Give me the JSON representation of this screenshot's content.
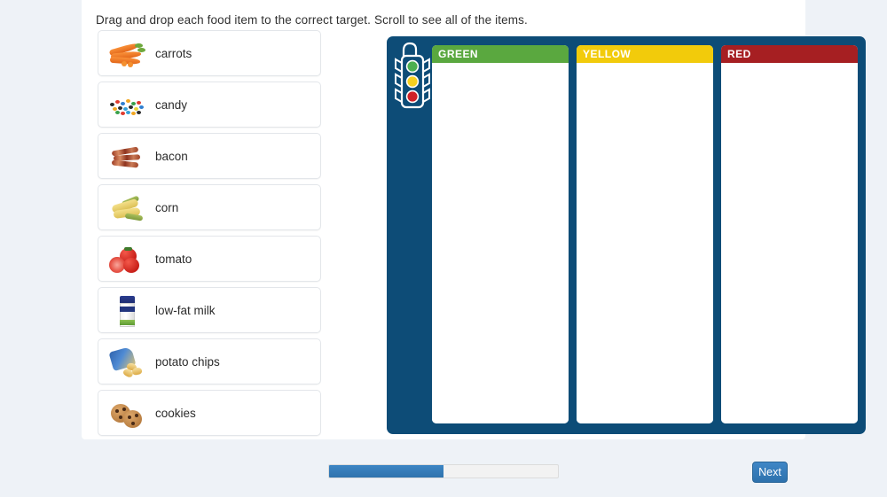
{
  "instructions": "Drag and drop each food item to the correct target. Scroll to see all of the items.",
  "items": [
    {
      "label": "carrots",
      "icon": "carrots-image"
    },
    {
      "label": "candy",
      "icon": "candy-image"
    },
    {
      "label": "bacon",
      "icon": "bacon-image"
    },
    {
      "label": "corn",
      "icon": "corn-image"
    },
    {
      "label": "tomato",
      "icon": "tomato-image"
    },
    {
      "label": "low-fat milk",
      "icon": "milk-carton-image"
    },
    {
      "label": "potato chips",
      "icon": "potato-chips-image"
    },
    {
      "label": "cookies",
      "icon": "cookies-image"
    }
  ],
  "drop_board": {
    "icon": "traffic-light-icon",
    "background_color": "#0d4c77",
    "columns": [
      {
        "label": "GREEN",
        "color": "#5aa83f",
        "items": []
      },
      {
        "label": "YELLOW",
        "color": "#f2cb0b",
        "items": []
      },
      {
        "label": "RED",
        "color": "#a61f22",
        "items": []
      }
    ]
  },
  "footer": {
    "progress_percent": 50,
    "next_label": "Next",
    "accent_color": "#2f73ad"
  }
}
